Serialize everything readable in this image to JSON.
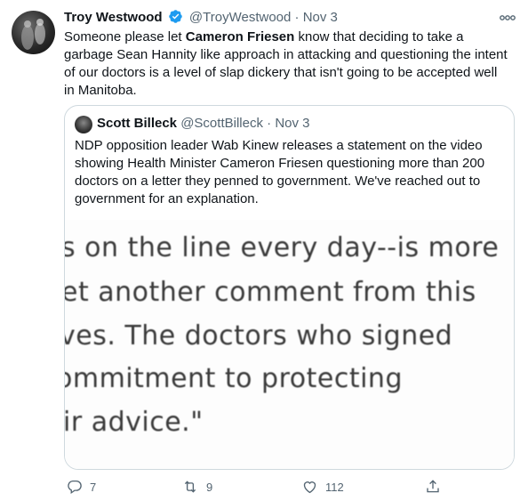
{
  "tweet": {
    "display_name": "Troy Westwood",
    "handle": "@TroyWestwood",
    "separator": "·",
    "date": "Nov 3",
    "text_before": "Someone please let ",
    "text_mention": "Cameron Friesen",
    "text_after": " know that deciding to take a garbage Sean Hannity like approach in attacking and questioning the intent of our doctors is a level of slap dickery that isn't going to be accepted well in Manitoba."
  },
  "quote": {
    "display_name": "Scott Billeck",
    "handle": "@ScottBilleck",
    "separator": "·",
    "date": "Nov 3",
    "text": "NDP opposition leader Wab Kinew releases a statement on the video showing Health Minister Cameron Friesen questioning more than 200 doctors on a letter they penned to government. We've reached out to government for an explanation.",
    "image_lines": [
      "s on the line every day--is more",
      "et another comment from this",
      "ves. The doctors who signed",
      "ommitment to protecting",
      "ir advice.\""
    ]
  },
  "actions": {
    "replies": "7",
    "retweets": "9",
    "likes": "112"
  },
  "icons": {
    "verified": "verified-badge-icon",
    "more": "more-options-icon",
    "reply": "reply-icon",
    "retweet": "retweet-icon",
    "like": "heart-icon",
    "share": "share-icon"
  },
  "colors": {
    "verified": "#1d9bf0",
    "text": "#0f1419",
    "muted": "#536471",
    "border": "#cfd9de"
  }
}
